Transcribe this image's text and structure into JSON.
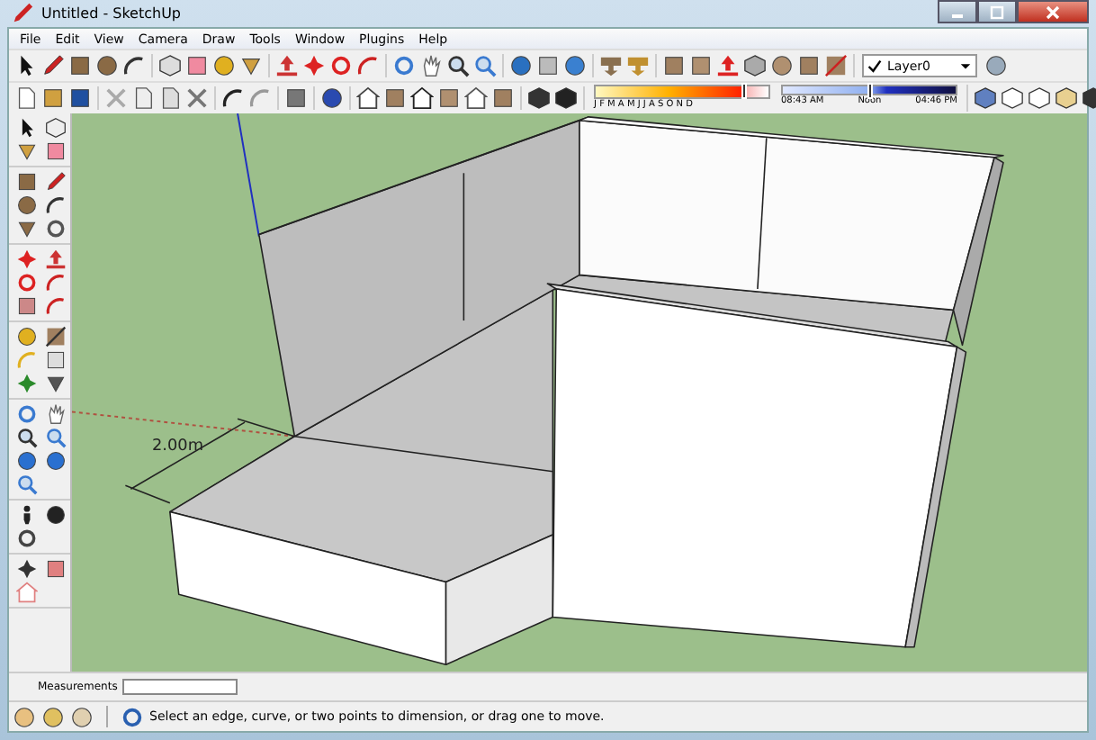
{
  "window": {
    "title": "Untitled - SketchUp"
  },
  "menu": [
    "File",
    "Edit",
    "View",
    "Camera",
    "Draw",
    "Tools",
    "Window",
    "Plugins",
    "Help"
  ],
  "layers": {
    "value": "Layer0"
  },
  "shadow_settings": {
    "date_slider": {
      "level": 0.85
    },
    "time_slider": {
      "level": 0.5
    },
    "months": "J F M A M J J A S O N D",
    "sunrise": "08:43 AM",
    "noon": "Noon",
    "sunset": "04:46 PM"
  },
  "viewport": {
    "dimension": "2.00m"
  },
  "measurements": {
    "label": "Measurements"
  },
  "status_bar": {
    "text": "Select an edge, curve, or two points to dimension, or drag one to move."
  }
}
